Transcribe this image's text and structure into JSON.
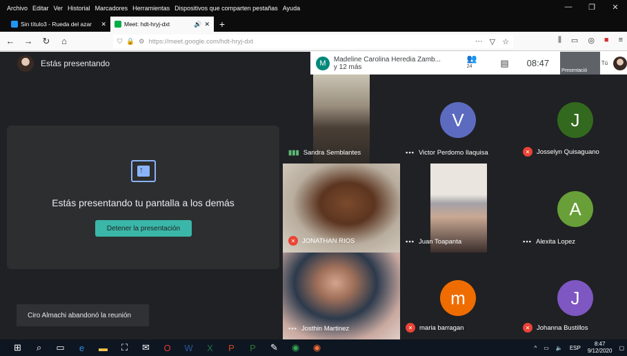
{
  "menubar": {
    "items": [
      "Archivo",
      "Editar",
      "Ver",
      "Historial",
      "Marcadores",
      "Herramientas",
      "Dispositivos que comparten pestañas",
      "Ayuda"
    ]
  },
  "tabs": [
    {
      "title": "Sin título3 - Rueda del azar",
      "active": false
    },
    {
      "title": "Meet: hdt-hryj-dxt",
      "active": true
    }
  ],
  "url": {
    "prefix": "https://meet.google.com/",
    "path": "hdt-hryj-dxt"
  },
  "meet": {
    "presenting_label": "Estás presentando",
    "participants_header": {
      "avatar_letter": "M",
      "name": "Madeline Carolina Heredia Zamb...",
      "more": "y 12 más",
      "count": "24",
      "time": "08:47",
      "self_preview": "Presentació",
      "self_label": "Tú"
    },
    "present_card": {
      "message": "Estás presentando tu pantalla a los demás",
      "stop_button": "Detener la presentación"
    },
    "toast": "Ciro Almachi abandonó la reunión",
    "tiles": [
      {
        "name": "Sandra Semblantes",
        "status": "speaking"
      },
      {
        "name": "Victor Perdomo Ilaquisa",
        "status": "dots",
        "letter": "V",
        "color": "#5c6bc0"
      },
      {
        "name": "Josselyn Quisaguano",
        "status": "muted",
        "letter": "J",
        "color": "#33691e"
      },
      {
        "name": "JONATHAN RIOS",
        "status": "muted"
      },
      {
        "name": "Juan Toapanta",
        "status": "dots"
      },
      {
        "name": "Alexita Lopez",
        "status": "dots",
        "letter": "A",
        "color": "#689f38"
      },
      {
        "name": "Josthin Martinez",
        "status": "dots"
      },
      {
        "name": "maria barragan",
        "status": "muted",
        "letter": "m",
        "color": "#ef6c00"
      },
      {
        "name": "Johanna Bustillos",
        "status": "muted",
        "letter": "J",
        "color": "#7e57c2"
      }
    ]
  },
  "taskbar": {
    "tray_lang": "ESP",
    "tray_time": "8:47",
    "tray_date": "9/12/2020"
  }
}
